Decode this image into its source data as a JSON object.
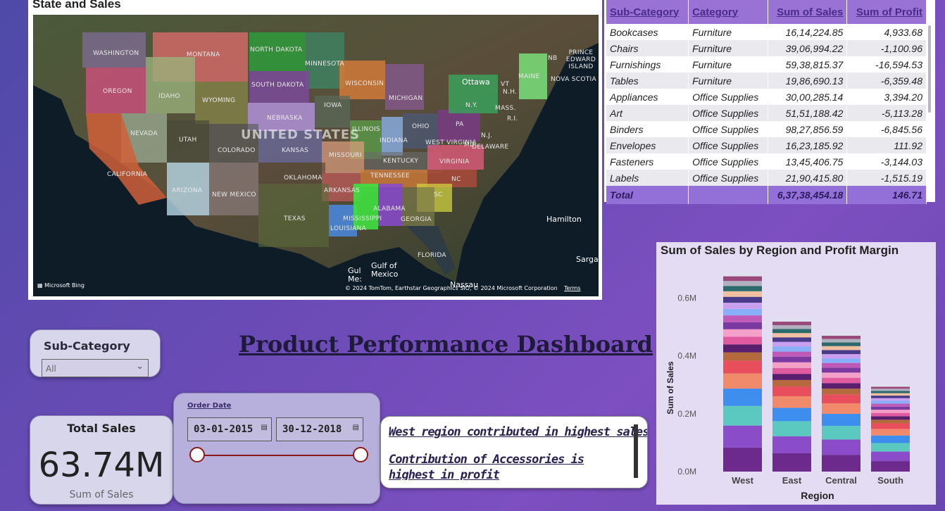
{
  "map": {
    "title": "State and Sales",
    "copyright": "© 2024 TomTom, Earthstar Geographics SIO, © 2024 Microsoft Corporation",
    "terms": "Terms",
    "provider": "Microsoft Bing",
    "country_label": "UNITED STATES",
    "state_labels": [
      "WASHINGTON",
      "MONTANA",
      "NORTH DAKOTA",
      "MINNESOTA",
      "OREGON",
      "IDAHO",
      "WYOMING",
      "SOUTH DAKOTA",
      "WISCONSIN",
      "MICHIGAN",
      "NEBRASKA",
      "IOWA",
      "ILLINOIS",
      "INDIANA",
      "OHIO",
      "PA",
      "NEVADA",
      "UTAH",
      "COLORADO",
      "KANSAS",
      "MISSOURI",
      "KENTUCKY",
      "WEST VIRGINIA",
      "VIRGINIA",
      "CALIFORNIA",
      "ARIZONA",
      "NEW MEXICO",
      "OKLAHOMA",
      "TENNESSEE",
      "NC",
      "ARKANSAS",
      "SC",
      "TEXAS",
      "MISSISSIPPI",
      "ALABAMA",
      "GEORGIA",
      "LOUISIANA",
      "FLORIDA",
      "N.Y.",
      "VT",
      "N.H.",
      "MAINE",
      "MASS.",
      "R.I.",
      "N.J.",
      "MD",
      "DELAWARE",
      "NOVA SCOTIA",
      "PRINCE EDWARD ISLAND",
      "NB"
    ],
    "place_labels": [
      "Ottawa",
      "Hamilton",
      "Gulf of Mexico",
      "Gul Me:",
      "Sarga",
      "Nassau"
    ]
  },
  "table": {
    "columns": [
      "Sub-Category",
      "Category",
      "Sum of Sales",
      "Sum of Profit"
    ],
    "rows": [
      [
        "Bookcases",
        "Furniture",
        "16,14,224.85",
        "4,933.68"
      ],
      [
        "Chairs",
        "Furniture",
        "39,06,994.22",
        "-1,100.96"
      ],
      [
        "Furnishings",
        "Furniture",
        "59,38,815.37",
        "-16,594.53"
      ],
      [
        "Tables",
        "Furniture",
        "19,86,690.13",
        "-6,359.48"
      ],
      [
        "Appliances",
        "Office Supplies",
        "30,00,285.14",
        "3,394.20"
      ],
      [
        "Art",
        "Office Supplies",
        "51,51,188.42",
        "-5,113.28"
      ],
      [
        "Binders",
        "Office Supplies",
        "98,27,856.59",
        "-6,845.56"
      ],
      [
        "Envelopes",
        "Office Supplies",
        "16,23,185.92",
        "111.92"
      ],
      [
        "Fasteners",
        "Office Supplies",
        "13,45,406.75",
        "-3,144.03"
      ],
      [
        "Labels",
        "Office Supplies",
        "21,90,415.80",
        "-1,515.19"
      ]
    ],
    "total": [
      "Total",
      "",
      "6,37,38,454.18",
      "146.71"
    ]
  },
  "dashboard_title": "Product Performance Dashboard",
  "slicer": {
    "title": "Sub-Category",
    "value": "All"
  },
  "date_slicer": {
    "title": "Order Date",
    "start": "03-01-2015",
    "end": "30-12-2018",
    "range_fraction": [
      0.0,
      1.0
    ]
  },
  "kpi": {
    "title": "Total Sales",
    "value": "63.74M",
    "caption": "Sum of Sales"
  },
  "insights": [
    "West region contributed in highest sales",
    "Contribution of Accessories is highest in profit"
  ],
  "colors": {
    "accent": "#9a72d6",
    "slider": "#8b1a1a",
    "bar_base": "#6b2a8c"
  },
  "chart_data": {
    "type": "bar",
    "title": "Sum of Sales by Region and Profit Margin",
    "xlabel": "Region",
    "ylabel": "Sum of Sales",
    "categories": [
      "West",
      "East",
      "Central",
      "South"
    ],
    "values": [
      0.69,
      0.53,
      0.48,
      0.3
    ],
    "ylim": [
      0,
      0.72
    ],
    "yticks": [
      "0.0M",
      "0.2M",
      "0.4M",
      "0.6M"
    ],
    "ytick_values": [
      0,
      0.2,
      0.4,
      0.6
    ],
    "stacked": true,
    "segment_colors": [
      "#6b2a8c",
      "#8a4cc8",
      "#5cc9c0",
      "#3e8ef0",
      "#f08a6a",
      "#e84e5c",
      "#b46a3c",
      "#5a1e6e",
      "#e05aa0",
      "#f4a0c8",
      "#7a3aa0",
      "#c05ab8",
      "#88b0f8",
      "#c9a0f0",
      "#4a3a8a",
      "#f0c0a0",
      "#2a6a6a",
      "#b0b0c0",
      "#9a4a7a",
      "#e0e0f0"
    ]
  }
}
